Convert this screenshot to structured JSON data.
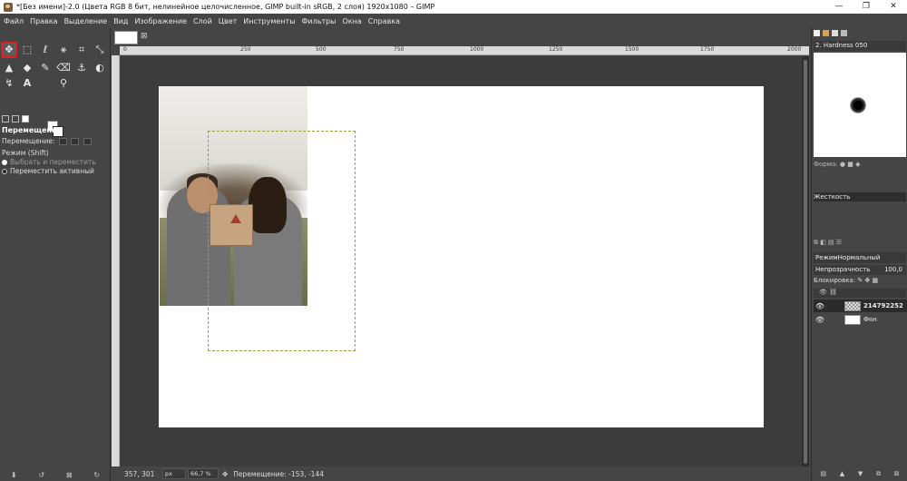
{
  "window": {
    "title": "*[Без имени]-2.0 (Цвета RGB 8 бит, нелинейное целочисленное, GIMP built-in sRGB, 2 слоя) 1920x1080 – GIMP",
    "controls": [
      "—",
      "❐",
      "✕"
    ]
  },
  "menu": [
    "Файл",
    "Правка",
    "Выделение",
    "Вид",
    "Изображение",
    "Слой",
    "Цвет",
    "Инструменты",
    "Фильтры",
    "Окна",
    "Справка"
  ],
  "toolbox": {
    "tools": [
      {
        "name": "move-tool",
        "glyph": "✥"
      },
      {
        "name": "rect-select-tool",
        "glyph": "⬚"
      },
      {
        "name": "lasso-tool",
        "glyph": "ℓ"
      },
      {
        "name": "fuzzy-select-tool",
        "glyph": "⚹"
      },
      {
        "name": "crop-tool",
        "glyph": "⌗"
      },
      {
        "name": "transform-tool",
        "glyph": "⤡"
      },
      {
        "name": "bucket-tool",
        "glyph": "▲"
      },
      {
        "name": "paint-tool",
        "glyph": "◆"
      },
      {
        "name": "brush-tool",
        "glyph": "✎"
      },
      {
        "name": "eraser-tool",
        "glyph": "⌫"
      },
      {
        "name": "clone-tool",
        "glyph": "⚓"
      },
      {
        "name": "smudge-tool",
        "glyph": "◐"
      },
      {
        "name": "path-tool",
        "glyph": "↯"
      },
      {
        "name": "text-tool",
        "glyph": "A"
      },
      {
        "name": "zoom-tool",
        "glyph": "⚲"
      }
    ],
    "options_title": "Перемещение",
    "move_label": "Перемещение:",
    "mode_label": "Режим (Shift)",
    "mode_option_1": "Выбрать и переместить",
    "mode_option_2": "Переместить активный"
  },
  "canvas": {
    "ruler_labels": [
      "0",
      "250",
      "500",
      "750",
      "1000",
      "1250",
      "1500",
      "1750",
      "2000"
    ]
  },
  "status": {
    "coords": "357, 301",
    "unit": "px",
    "zoom": "66,7 %",
    "message": "Перемещение: -153, -144"
  },
  "dock": {
    "brush_name": "2. Hardness 050",
    "shape_label": "Форма:",
    "hardness_label": "Жесткость",
    "mode_label": "Режим",
    "mode_value": "Нормальный",
    "opacity_label": "Непрозрачность",
    "opacity_value": "100,0",
    "lock_label": "Блокировка:",
    "layers": [
      {
        "name": "214792252",
        "thumb": "checker"
      },
      {
        "name": "Фон",
        "thumb": "white"
      }
    ]
  }
}
